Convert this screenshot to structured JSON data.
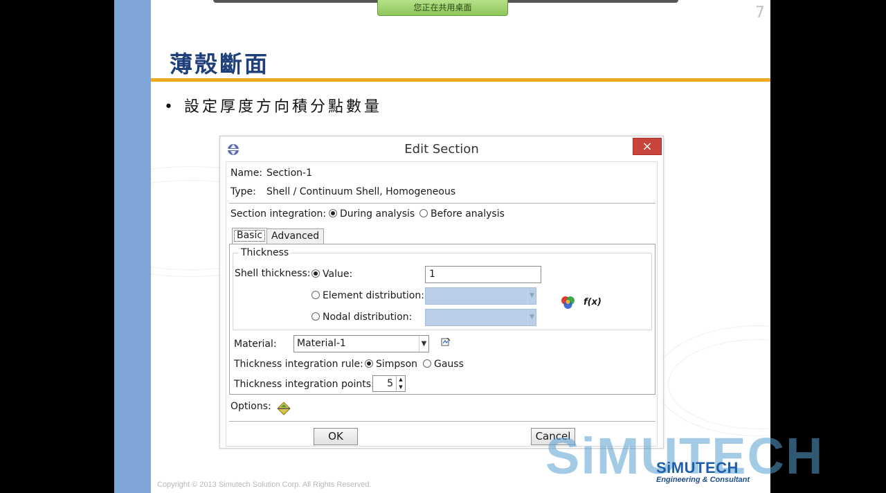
{
  "share_banner": "您正在共用桌面",
  "slide": {
    "page_number": "7",
    "title": "薄殼斷面",
    "bullet": "設定厚度方向積分點數量",
    "copyright": "Copyright © 2013 Simutech Solution Corp. All Rights Reserved."
  },
  "dialog": {
    "title": "Edit Section",
    "close_glyph": "×",
    "name_label": "Name:",
    "name_value": "Section-1",
    "type_label": "Type:",
    "type_value": "Shell / Continuum Shell, Homogeneous",
    "section_integration_label": "Section integration:",
    "section_integration_options": [
      "During analysis",
      "Before analysis"
    ],
    "section_integration_selected": "During analysis",
    "tabs": [
      "Basic",
      "Advanced"
    ],
    "active_tab": "Basic",
    "thickness_group_label": "Thickness",
    "shell_thickness_label": "Shell thickness:",
    "thickness_options": [
      "Value:",
      "Element distribution:",
      "Nodal distribution:"
    ],
    "thickness_selected": "Value:",
    "thickness_value": "1",
    "function_label": "f(x)",
    "material_label": "Material:",
    "material_value": "Material-1",
    "integration_rule_label": "Thickness integration rule:",
    "integration_rule_options": [
      "Simpson",
      "Gauss"
    ],
    "integration_rule_selected": "Simpson",
    "integration_points_label": "Thickness integration points:",
    "integration_points_value": "5",
    "options_label": "Options:",
    "ok_label": "OK",
    "cancel_label": "Cancel"
  },
  "logos": {
    "big": "SiMUTECH",
    "small": "SiMUTECH",
    "tagline": "Engineering & Consultant"
  },
  "colors": {
    "title_blue": "#1f3f7a",
    "title_rule_orange": "#f2a81d",
    "left_bar_blue": "#7ea6d8",
    "close_red": "#c9443a",
    "disabled_combo_blue": "#b9cfe9"
  }
}
